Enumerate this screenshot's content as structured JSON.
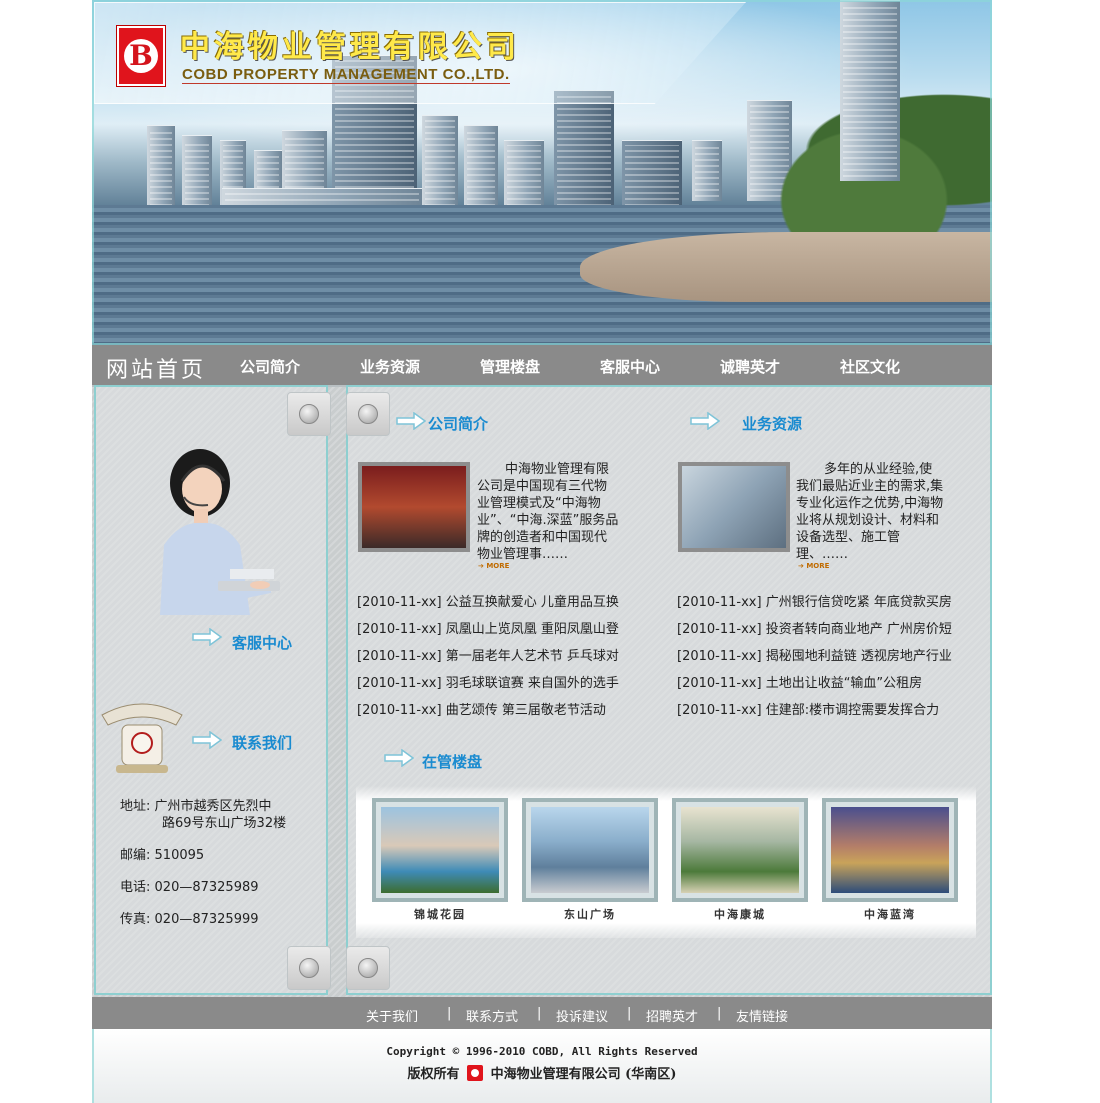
{
  "header": {
    "company_cn": "中海物业管理有限公司",
    "company_en": "COBD PROPERTY MANAGEMENT CO.,LTD.",
    "logo_letter": "B"
  },
  "nav": {
    "home": "网站首页",
    "items": [
      "公司简介",
      "业务资源",
      "管理楼盘",
      "客服中心",
      "诚聘英才",
      "社区文化"
    ]
  },
  "sidebar": {
    "service_title": "客服中心",
    "contact_title": "联系我们",
    "address_label": "地址:",
    "address_line1": "广州市越秀区先烈中",
    "address_line2": "路69号东山广场32楼",
    "postcode_label": "邮编:",
    "postcode": "510095",
    "phone_label": "电话:",
    "phone": "020—87325989",
    "fax_label": "传真:",
    "fax": "020—87325999"
  },
  "intro": {
    "company_title": "公司简介",
    "company_text": "中海物业管理有限公司是中国现有三代物业管理模式及“中海物业”、“中海.深蓝”服务品牌的创造者和中国现代物业管理事……",
    "business_title": "业务资源",
    "business_text": "多年的从业经验,使我们最贴近业主的需求,集专业化运作之优势,中海物业将从规划设计、材料和设备选型、施工管理、……",
    "more_label": "MORE"
  },
  "news_left": [
    {
      "date": "[2010-11-xx]",
      "title": "公益互换献爱心 儿童用品互换"
    },
    {
      "date": "[2010-11-xx]",
      "title": "凤凰山上览凤凰 重阳凤凰山登"
    },
    {
      "date": "[2010-11-xx]",
      "title": "第一届老年人艺术节 乒乓球对"
    },
    {
      "date": "[2010-11-xx]",
      "title": "羽毛球联谊赛 来自国外的选手"
    },
    {
      "date": "[2010-11-xx]",
      "title": "曲艺颂传 第三届敬老节活动"
    }
  ],
  "news_right": [
    {
      "date": "[2010-11-xx]",
      "title": "广州银行信贷吃紧 年底贷款买房"
    },
    {
      "date": "[2010-11-xx]",
      "title": "投资者转向商业地产 广州房价短"
    },
    {
      "date": "[2010-11-xx]",
      "title": "揭秘囤地利益链 透视房地产行业"
    },
    {
      "date": "[2010-11-xx]",
      "title": "土地出让收益“输血”公租房"
    },
    {
      "date": "[2010-11-xx]",
      "title": "住建部:楼市调控需要发挥合力"
    }
  ],
  "properties": {
    "title": "在管楼盘",
    "items": [
      "锦城花园",
      "东山广场",
      "中海康城",
      "中海蓝湾"
    ]
  },
  "footer": {
    "links": [
      "关于我们",
      "联系方式",
      "投诉建议",
      "招聘英才",
      "友情链接"
    ],
    "separator": "|",
    "copyright": "Copyright © 1996-2010 COBD, All Rights Reserved",
    "owner_prefix": "版权所有",
    "owner_name": "中海物业管理有限公司 (华南区)"
  },
  "colors": {
    "accent_blue": "#1a8bd0",
    "nav_gray": "#8a8a8a",
    "frame_teal": "#8ecfd0",
    "logo_red": "#e0141c",
    "logo_yellow": "#ffe94a"
  }
}
